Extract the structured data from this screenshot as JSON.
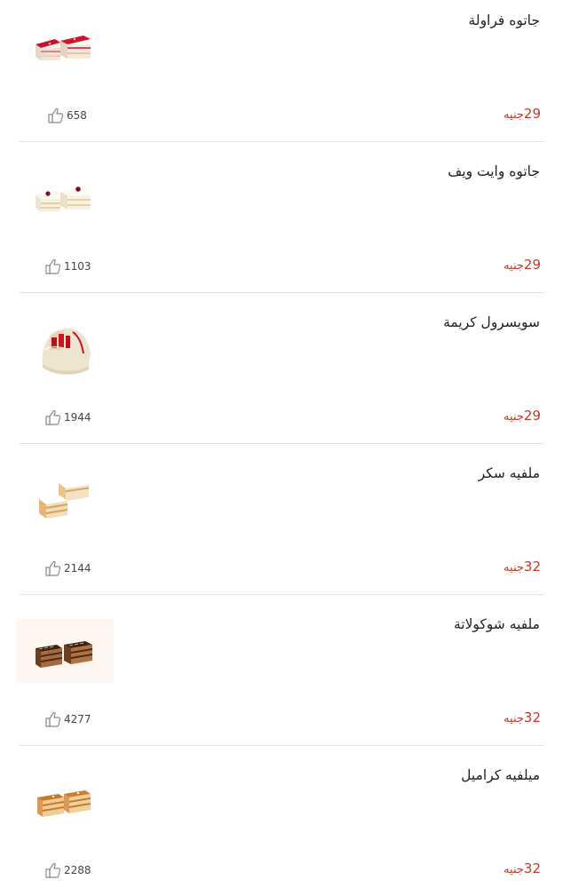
{
  "menu": {
    "items": [
      {
        "name": "جاتوه فراولة",
        "price": "29",
        "currency": "جنيه",
        "likes": "658",
        "image": "strawberry-gateau"
      },
      {
        "name": "جاتوه وايت ويف",
        "price": "29",
        "currency": "جنيه",
        "likes": "1103",
        "image": "white-wave-gateau"
      },
      {
        "name": "سويسرول كريمة",
        "price": "29",
        "currency": "جنيه",
        "likes": "1944",
        "image": "cream-swiss-roll"
      },
      {
        "name": "ملفيه سكر",
        "price": "32",
        "currency": "جنيه",
        "likes": "2144",
        "image": "sugar-mille-feuille"
      },
      {
        "name": "ملفيه شوكولاتة",
        "price": "32",
        "currency": "جنيه",
        "likes": "4277",
        "image": "chocolate-mille-feuille"
      },
      {
        "name": "ميلفيه كراميل",
        "price": "32",
        "currency": "جنيه",
        "likes": "2288",
        "image": "caramel-mille-feuille"
      }
    ]
  },
  "colors": {
    "price": "#c0392b",
    "divider": "#e3e3e3",
    "text": "#222222"
  },
  "icons": {
    "like": "thumbs-up-icon"
  }
}
